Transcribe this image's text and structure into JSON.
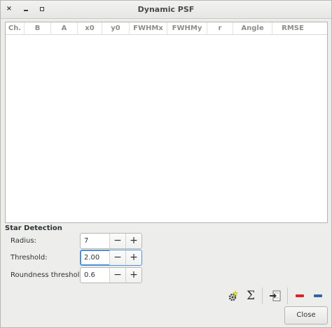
{
  "window": {
    "title": "Dynamic PSF",
    "close_glyph": "×",
    "minimize_glyph": "",
    "maximize_glyph": ""
  },
  "table": {
    "columns": [
      "Ch.",
      "B",
      "A",
      "x0",
      "y0",
      "FWHMx",
      "FWHMy",
      "r",
      "Angle",
      "RMSE"
    ],
    "rows": []
  },
  "star_detection": {
    "title": "Star Detection",
    "fields": [
      {
        "label": "Radius:",
        "value": "7",
        "minus": "−",
        "plus": "+"
      },
      {
        "label": "Threshold:",
        "value": "2.00",
        "minus": "−",
        "plus": "+"
      },
      {
        "label": "Roundness threshold:",
        "value": "0.6",
        "minus": "−",
        "plus": "+"
      }
    ]
  },
  "toolbar": {
    "icons": [
      "gear-icon",
      "sigma-icon",
      "export-icon",
      "remove-red-icon",
      "remove-blue-icon"
    ],
    "sigma_glyph": "Σ",
    "colors": {
      "red": "#d9242a",
      "blue": "#3465a4",
      "gear": "#3b3b3b",
      "star": "#e6e600"
    }
  },
  "close_button": {
    "label": "Close"
  }
}
